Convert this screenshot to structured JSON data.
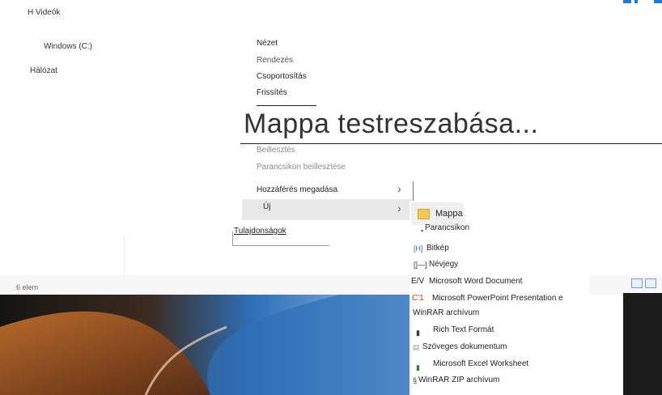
{
  "tree": {
    "videos": "H Videók",
    "windows_c": "Windows (C:)",
    "network": "Hálózat"
  },
  "context_menu": {
    "view": "Nézet",
    "sort": "Rendezés",
    "group": "Csoportosítás",
    "refresh": "Frissítés",
    "customize": "Mappa testreszabása...",
    "paste": "Beillesztés",
    "paste_shortcut": "Parancsikon beillesztése",
    "give_access": "Hozzáférés megadása",
    "new": "Új",
    "properties": "Tulajdonságok"
  },
  "submenu": {
    "folder": "Mappa",
    "shortcut": "Parancsikon",
    "bitmap": "Bitkép",
    "contact": "Névjegy",
    "word_prefix": "E/V",
    "word": "Microsoft Word Document",
    "ppt_prefix": "C'1",
    "ppt": "Microsoft PowerPoint Presentation e",
    "winrar": "WinRAR archívum",
    "rtf": "Rich Text Formát",
    "txt": "Szöveges dokumentum",
    "excel": "Microsoft Excel Worksheet",
    "zip": "WinRAR ZIP archívum"
  },
  "icons": {
    "bitmap_prefix": "[H]",
    "contact_prefix": "[]—]"
  },
  "status": {
    "items": "6 elem"
  },
  "colors": {
    "accent_blue": "#1e78d6",
    "folder_yellow": "#f3c85a",
    "desktop_dark": "#141414",
    "desktop_blue": "#2f6fb8",
    "desktop_orange": "#c9732e"
  }
}
